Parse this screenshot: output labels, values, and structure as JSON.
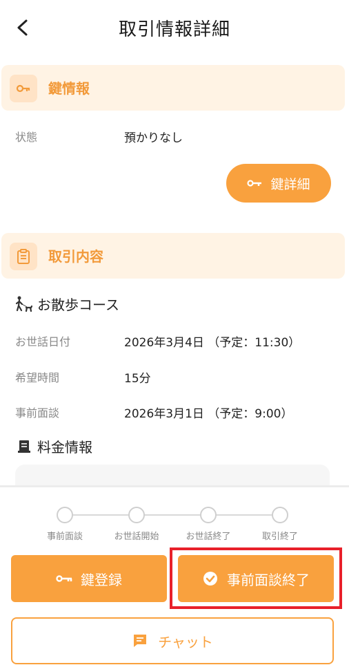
{
  "header": {
    "title": "取引情報詳細"
  },
  "key_section": {
    "title": "鍵情報",
    "status_label": "状態",
    "status_value": "預かりなし",
    "detail_button": "鍵詳細"
  },
  "deal_section": {
    "title": "取引内容",
    "course": "お散歩コース",
    "rows": [
      {
        "label": "お世話日付",
        "value": "2026年3月4日 （予定：11:30）"
      },
      {
        "label": "希望時間",
        "value": "15分"
      },
      {
        "label": "事前面談",
        "value": "2026年3月1日 （予定：9:00）"
      }
    ],
    "fee_title": "料金情報"
  },
  "steps": [
    "事前面談",
    "お世話開始",
    "お世話終了",
    "取引終了"
  ],
  "actions": {
    "key_register": "鍵登録",
    "interview_finish": "事前面談終了",
    "chat": "チャット"
  },
  "colors": {
    "accent": "#f9a13e",
    "accent_text": "#f29a3a",
    "section_bg": "#fff3e4",
    "highlight": "#e8202a"
  }
}
